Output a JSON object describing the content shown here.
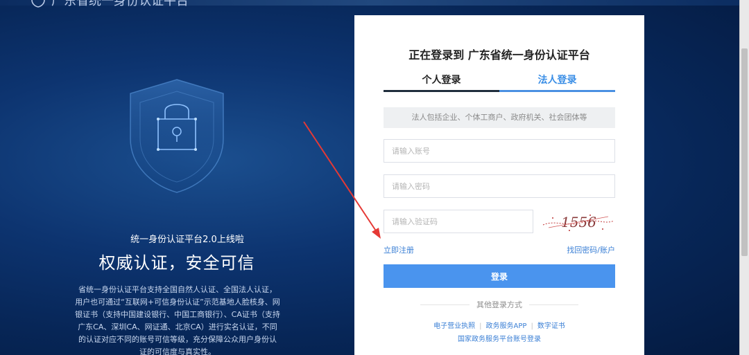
{
  "brand": {
    "title": "广东省统一身份认证平台"
  },
  "left": {
    "subtitle": "统一身份认证平台2.0上线啦",
    "title": "权威认证，安全可信",
    "description": "省统一身份认证平台支持全国自然人认证、全国法人认证，用户也可通过“互联网+可信身份认证”示范基地人脸核身、网银证书（支持中国建设银行、中国工商银行）、CA证书（支持广东CA、深圳CA、网证通、北京CA）进行实名认证，不同的认证对应不同的账号可信等级，充分保障公众用户身份认证的可信度与真实性。"
  },
  "card": {
    "title": "正在登录到 广东省统一身份认证平台",
    "tabs": [
      {
        "label": "个人登录",
        "active": true
      },
      {
        "label": "法人登录",
        "active": false
      }
    ],
    "hint": "法人包括企业、个体工商户、政府机关、社会团体等",
    "account_placeholder": "请输入账号",
    "password_placeholder": "请输入密码",
    "captcha_placeholder": "请输入验证码",
    "captcha_text": "1556",
    "register_link": "立即注册",
    "recover_link": "找回密码/账户",
    "login_button": "登录",
    "other_label": "其他登录方式",
    "other_links": [
      "电子营业执照",
      "政务服务APP",
      "数字证书"
    ],
    "national_link": "国家政务服务平台账号登录"
  },
  "colors": {
    "accent": "#4a94ee",
    "link": "#3a7fd5",
    "annotation_arrow": "#e53935"
  }
}
